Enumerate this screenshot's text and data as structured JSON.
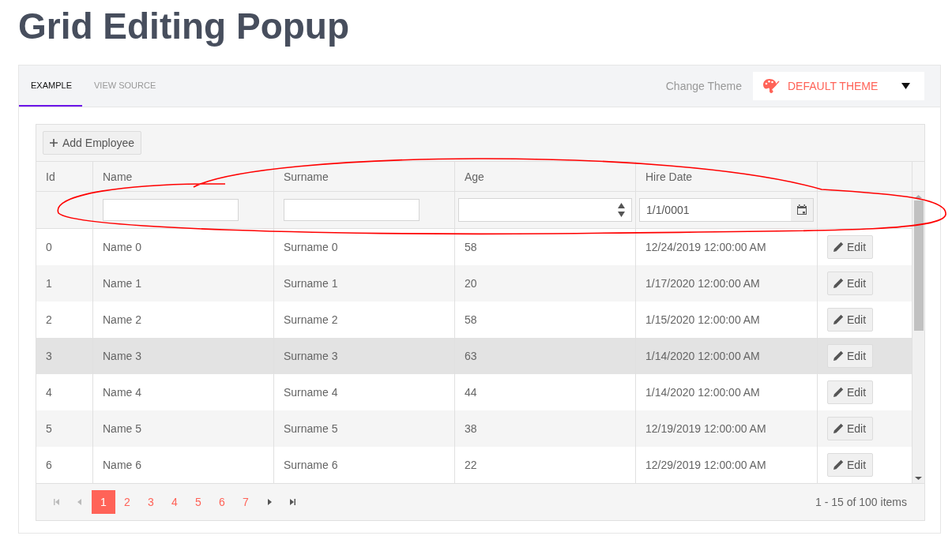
{
  "page_title": "Grid Editing Popup",
  "tabs": [
    {
      "label": "EXAMPLE",
      "selected": true
    },
    {
      "label": "VIEW SOURCE",
      "selected": false
    }
  ],
  "theme": {
    "label": "Change Theme",
    "value": "DEFAULT THEME"
  },
  "toolbar": {
    "add_button": "Add Employee"
  },
  "columns": [
    "Id",
    "Name",
    "Surname",
    "Age",
    "Hire Date"
  ],
  "filter_row": [
    {
      "kind": "none"
    },
    {
      "kind": "text"
    },
    {
      "kind": "text"
    },
    {
      "kind": "numeric"
    },
    {
      "kind": "date",
      "value": "1/1/0001"
    },
    {
      "kind": "none"
    }
  ],
  "rows": [
    {
      "cells": [
        "0",
        "Name 0",
        "Surname 0",
        "58",
        "12/24/2019 12:00:00 AM"
      ],
      "action": "Edit",
      "highlighted": false
    },
    {
      "cells": [
        "1",
        "Name 1",
        "Surname 1",
        "20",
        "1/17/2020 12:00:00 AM"
      ],
      "action": "Edit",
      "highlighted": false
    },
    {
      "cells": [
        "2",
        "Name 2",
        "Surname 2",
        "58",
        "1/15/2020 12:00:00 AM"
      ],
      "action": "Edit",
      "highlighted": false
    },
    {
      "cells": [
        "3",
        "Name 3",
        "Surname 3",
        "63",
        "1/14/2020 12:00:00 AM"
      ],
      "action": "Edit",
      "highlighted": true
    },
    {
      "cells": [
        "4",
        "Name 4",
        "Surname 4",
        "44",
        "1/14/2020 12:00:00 AM"
      ],
      "action": "Edit",
      "highlighted": false
    },
    {
      "cells": [
        "5",
        "Name 5",
        "Surname 5",
        "38",
        "12/19/2019 12:00:00 AM"
      ],
      "action": "Edit",
      "highlighted": false
    },
    {
      "cells": [
        "6",
        "Name 6",
        "Surname 6",
        "22",
        "12/29/2019 12:00:00 AM"
      ],
      "action": "Edit",
      "highlighted": false
    }
  ],
  "pager": {
    "nav_before": [
      {
        "kind": "first",
        "disabled": true
      },
      {
        "kind": "prev",
        "disabled": true
      }
    ],
    "pages": [
      {
        "label": "1",
        "selected": true
      },
      {
        "label": "2",
        "selected": false
      },
      {
        "label": "3",
        "selected": false
      },
      {
        "label": "4",
        "selected": false
      },
      {
        "label": "5",
        "selected": false
      },
      {
        "label": "6",
        "selected": false
      },
      {
        "label": "7",
        "selected": false
      }
    ],
    "nav_after": [
      {
        "kind": "next",
        "disabled": false
      },
      {
        "kind": "last",
        "disabled": false
      }
    ],
    "summary": "1 - 15 of 100 items"
  }
}
